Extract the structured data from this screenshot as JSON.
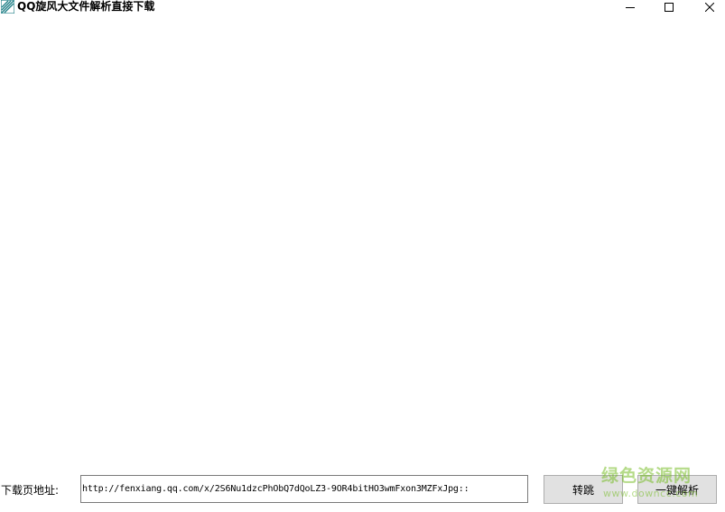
{
  "window": {
    "title": "QQ旋风大文件解析直接下载",
    "icon": "qq-whirlwind-app-icon"
  },
  "titlebar_controls": {
    "minimize_icon": "minimize-icon",
    "maximize_icon": "maximize-icon",
    "close_icon": "close-icon"
  },
  "form": {
    "address_label": "下载页地址:",
    "url_value": "http://fenxiang.qq.com/x/2S6Nu1dzcPhObQ7dQoLZ3-9OR4bitHO3wmFxon3MZFxJpg::",
    "jump_button": "转跳",
    "parse_button": "一键解析"
  },
  "watermark": {
    "main": "绿色资源网",
    "sub": "www.downcc.com"
  },
  "colors": {
    "background": "#ffffff",
    "button_face": "#e1e1e1",
    "button_border": "#adadad",
    "input_border": "#7a7a7a",
    "icon_teal": "#1e7f86",
    "watermark_green": "#78be28"
  }
}
